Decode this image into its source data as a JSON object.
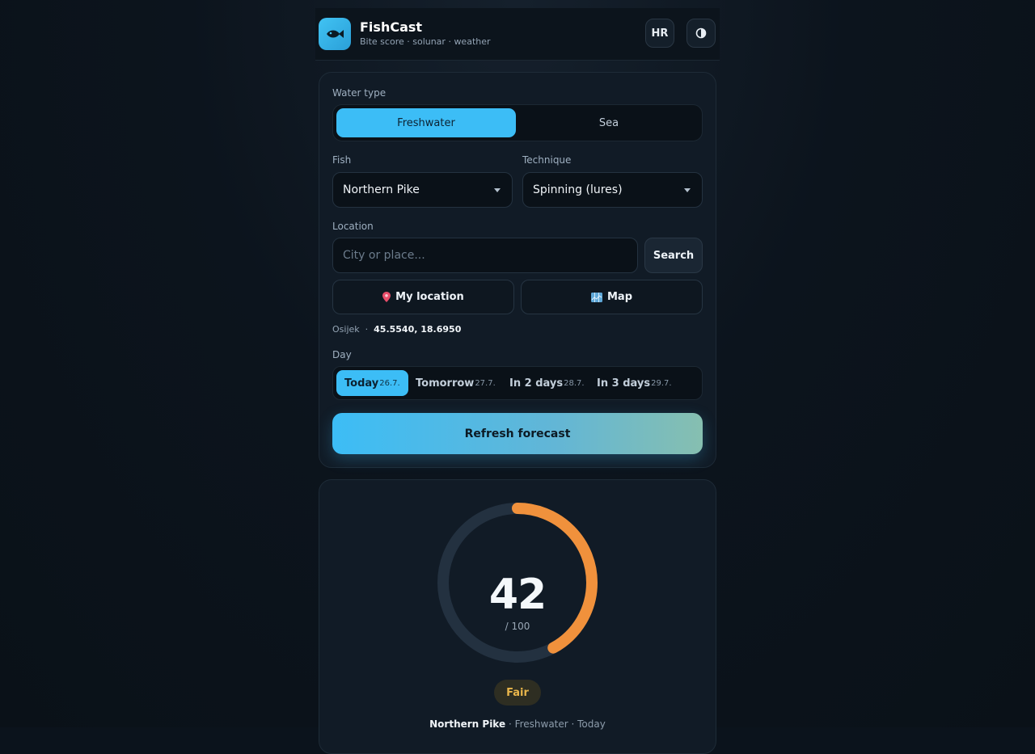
{
  "header": {
    "title": "FishCast",
    "subtitle": "Bite score · solunar · weather",
    "lang_label": "HR"
  },
  "form": {
    "water_label": "Water type",
    "water_options": [
      "Freshwater",
      "Sea"
    ],
    "fish_label": "Fish",
    "fish_value": "Northern Pike",
    "technique_label": "Technique",
    "technique_value": "Spinning (lures)",
    "location_label": "Location",
    "search_placeholder": "City or place...",
    "search_button": "Search",
    "my_location_button": "My location",
    "map_button": "Map",
    "place_name": "Osijek",
    "coords": "45.5540, 18.6950",
    "day_label": "Day",
    "days": [
      {
        "label": "Today",
        "date": "26.7."
      },
      {
        "label": "Tomorrow",
        "date": "27.7."
      },
      {
        "label": "In 2 days",
        "date": "28.7."
      },
      {
        "label": "In 3 days",
        "date": "29.7."
      }
    ],
    "refresh_button": "Refresh forecast"
  },
  "score": {
    "value": 42,
    "max_label": "/ 100",
    "rating": "Fair",
    "fish": "Northern Pike",
    "meta": "· Freshwater · Today",
    "gauge_color": "#f0913c",
    "track_color": "#233140"
  },
  "colors": {
    "accent": "#3cbdf6",
    "rating": "#e9b64b"
  }
}
